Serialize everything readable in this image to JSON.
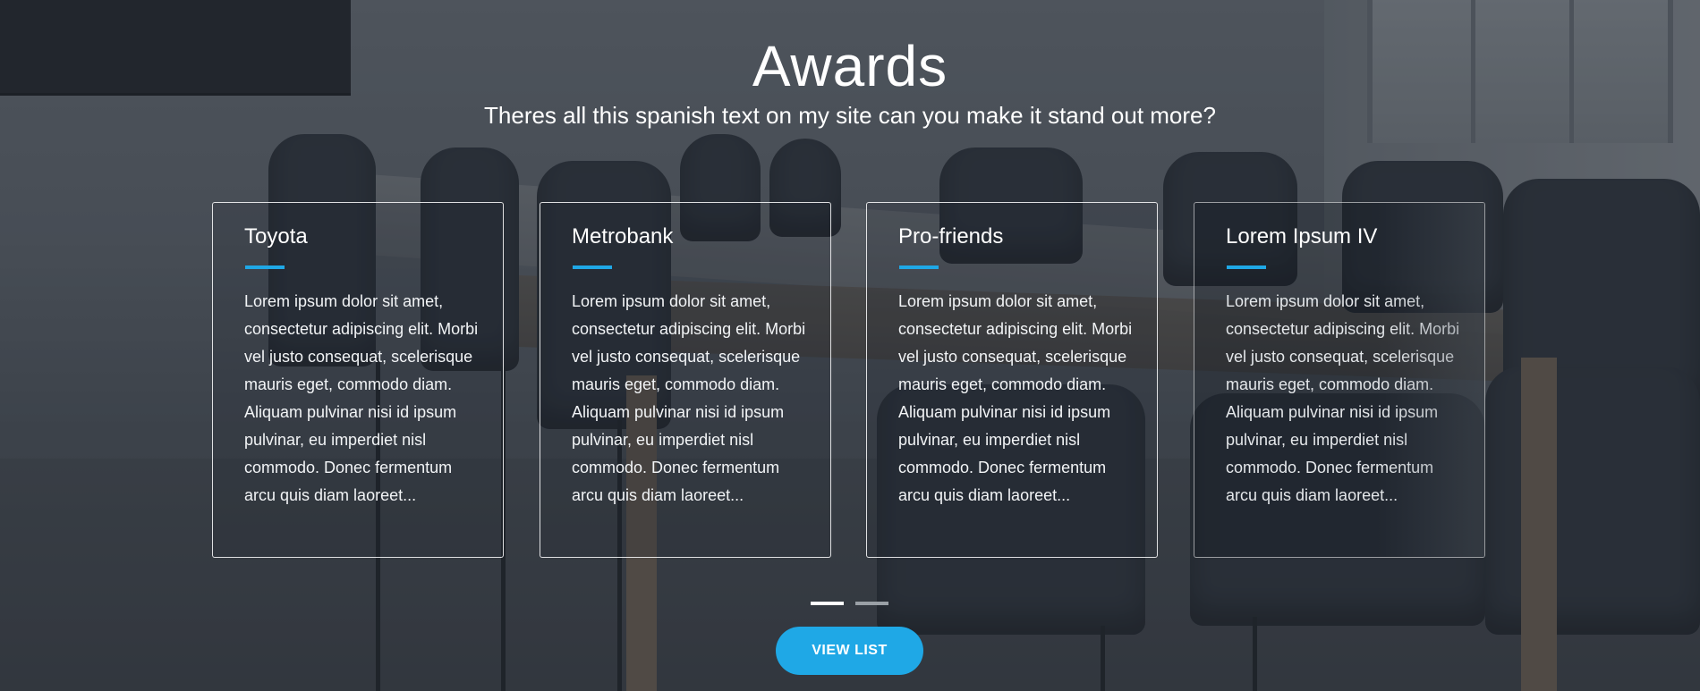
{
  "section": {
    "title": "Awards",
    "subtitle": "Theres all this spanish text on my site can you make it stand out more?"
  },
  "cards": [
    {
      "title": "Toyota",
      "body": "Lorem ipsum dolor sit amet, consectetur adipiscing elit. Morbi vel justo consequat, scelerisque mauris eget, commodo diam. Aliquam pulvinar nisi id ipsum pulvinar, eu imperdiet nisl commodo. Donec fermentum arcu quis diam laoreet..."
    },
    {
      "title": "Metrobank",
      "body": "Lorem ipsum dolor sit amet, consectetur adipiscing elit. Morbi vel justo consequat, scelerisque mauris eget, commodo diam. Aliquam pulvinar nisi id ipsum pulvinar, eu imperdiet nisl commodo. Donec fermentum arcu quis diam laoreet..."
    },
    {
      "title": "Pro-friends",
      "body": "Lorem ipsum dolor sit amet, consectetur adipiscing elit. Morbi vel justo consequat, scelerisque mauris eget, commodo diam. Aliquam pulvinar nisi id ipsum pulvinar, eu imperdiet nisl commodo. Donec fermentum arcu quis diam laoreet..."
    },
    {
      "title": "Lorem Ipsum IV",
      "body": "Lorem ipsum dolor sit amet, consectetur adipiscing elit. Morbi vel justo consequat, scelerisque mauris eget, commodo diam. Aliquam pulvinar nisi id ipsum pulvinar, eu imperdiet nisl commodo. Donec fermentum arcu quis diam laoreet..."
    }
  ],
  "pager": {
    "pages": 2,
    "active_page": 1
  },
  "view_list_button": {
    "label": "VIEW LIST"
  },
  "colors": {
    "accent": "#1fa8e6",
    "text": "#ffffff"
  }
}
